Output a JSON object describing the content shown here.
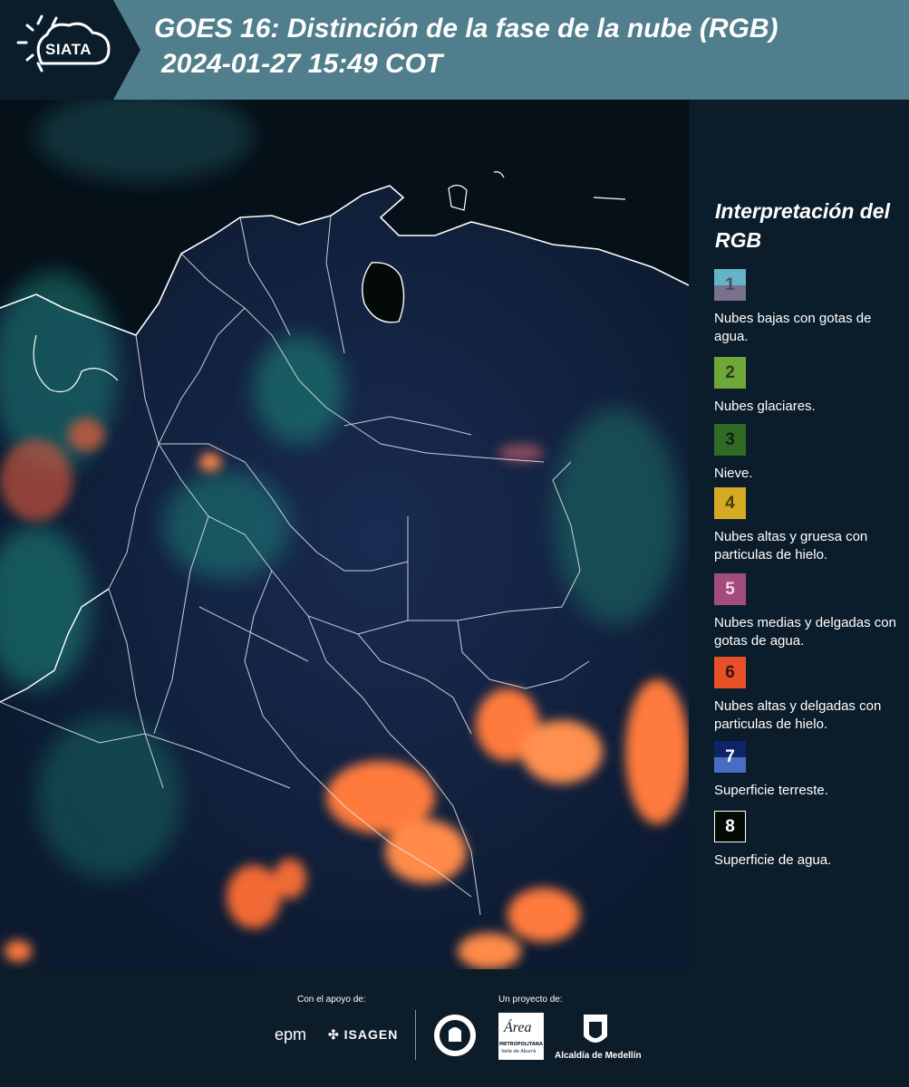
{
  "header": {
    "logo_text": "SIATA",
    "title_line1": "GOES 16: Distinción de la fase de la nube (RGB)",
    "title_line2": "2024-01-27 15:49 COT"
  },
  "colors": {
    "header_bg": "#507e8c",
    "panel_bg": "#0b1c2a",
    "map_bg": "#06121c",
    "cloud_orange": "#ff7a3d",
    "cloud_teal": "#2fa89a"
  },
  "legend": {
    "title": "Interpretación del RGB",
    "items": [
      {
        "number": "1",
        "label": "Nubes bajas con gotas de agua.",
        "color_top": "#63b5c6",
        "color_bottom": "#7a728c",
        "text_color": "#4a4a5a"
      },
      {
        "number": "2",
        "label": "Nubes glaciares.",
        "color": "#6fa83a",
        "text_color": "#2f3a22"
      },
      {
        "number": "3",
        "label": "Nieve.",
        "color": "#2f6b24",
        "text_color": "#0f1f0d"
      },
      {
        "number": "4",
        "label": "Nubes altas y gruesa con particulas de hielo.",
        "color": "#d4ab23",
        "text_color": "#4a3a0a"
      },
      {
        "number": "5",
        "label": "Nubes medias y delgadas con gotas de agua.",
        "color": "#a24c7c",
        "text_color": "#f0d8e6"
      },
      {
        "number": "6",
        "label": "Nubes altas y delgadas con particulas de hielo.",
        "color": "#e8502a",
        "text_color": "#3a1208"
      },
      {
        "number": "7",
        "label": "Superficie terreste.",
        "color_top": "#0f2367",
        "color_bottom": "#4a6cc2",
        "text_color": "#ffffff"
      },
      {
        "number": "8",
        "label": "Superficie de agua.",
        "color": "#050905",
        "text_color": "#ffffff"
      }
    ]
  },
  "footer": {
    "support_label": "Con el apoyo de:",
    "project_label": "Un proyecto de:",
    "sponsor_epm": "epm",
    "sponsor_isagen": "ISAGEN",
    "area_logo_text": "Área",
    "area_caption": "METROPOLITANA",
    "area_subcaption": "Valle de Aburrá",
    "alcaldia": "Alcaldía de Medellín"
  }
}
